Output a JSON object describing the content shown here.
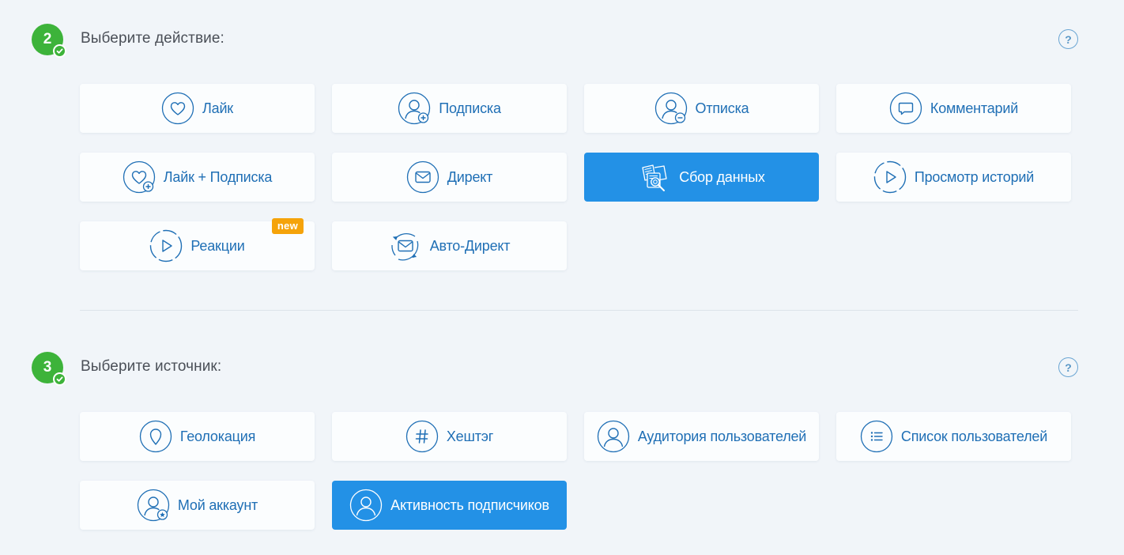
{
  "colors": {
    "step_badge": "#3db33a",
    "accent": "#2391e6",
    "link_text": "#1f6fb5",
    "new_badge": "#f5a30a"
  },
  "step_action": {
    "number": "2",
    "title": "Выберите действие:",
    "help": "?",
    "options": [
      {
        "label": "Лайк",
        "icon": "heart-icon"
      },
      {
        "label": "Подписка",
        "icon": "user-plus-icon"
      },
      {
        "label": "Отписка",
        "icon": "user-minus-icon"
      },
      {
        "label": "Комментарий",
        "icon": "comment-icon"
      },
      {
        "label": "Лайк + Подписка",
        "icon": "heart-plus-icon"
      },
      {
        "label": "Директ",
        "icon": "envelope-icon"
      },
      {
        "label": "Сбор данных",
        "icon": "data-collection-icon",
        "selected": true
      },
      {
        "label": "Просмотр историй",
        "icon": "story-play-icon"
      },
      {
        "label": "Реакции",
        "icon": "reaction-play-icon",
        "badge": "new"
      },
      {
        "label": "Авто-Директ",
        "icon": "auto-direct-icon"
      }
    ]
  },
  "step_source": {
    "number": "3",
    "title": "Выберите источник:",
    "help": "?",
    "options": [
      {
        "label": "Геолокация",
        "icon": "location-pin-icon"
      },
      {
        "label": "Хештэг",
        "icon": "hashtag-icon"
      },
      {
        "label": "Аудитория пользователей",
        "icon": "user-icon"
      },
      {
        "label": "Список пользователей",
        "icon": "list-icon"
      },
      {
        "label": "Мой аккаунт",
        "icon": "user-star-icon"
      },
      {
        "label": "Активность подписчиков",
        "icon": "user-activity-icon",
        "selected": true
      }
    ]
  }
}
